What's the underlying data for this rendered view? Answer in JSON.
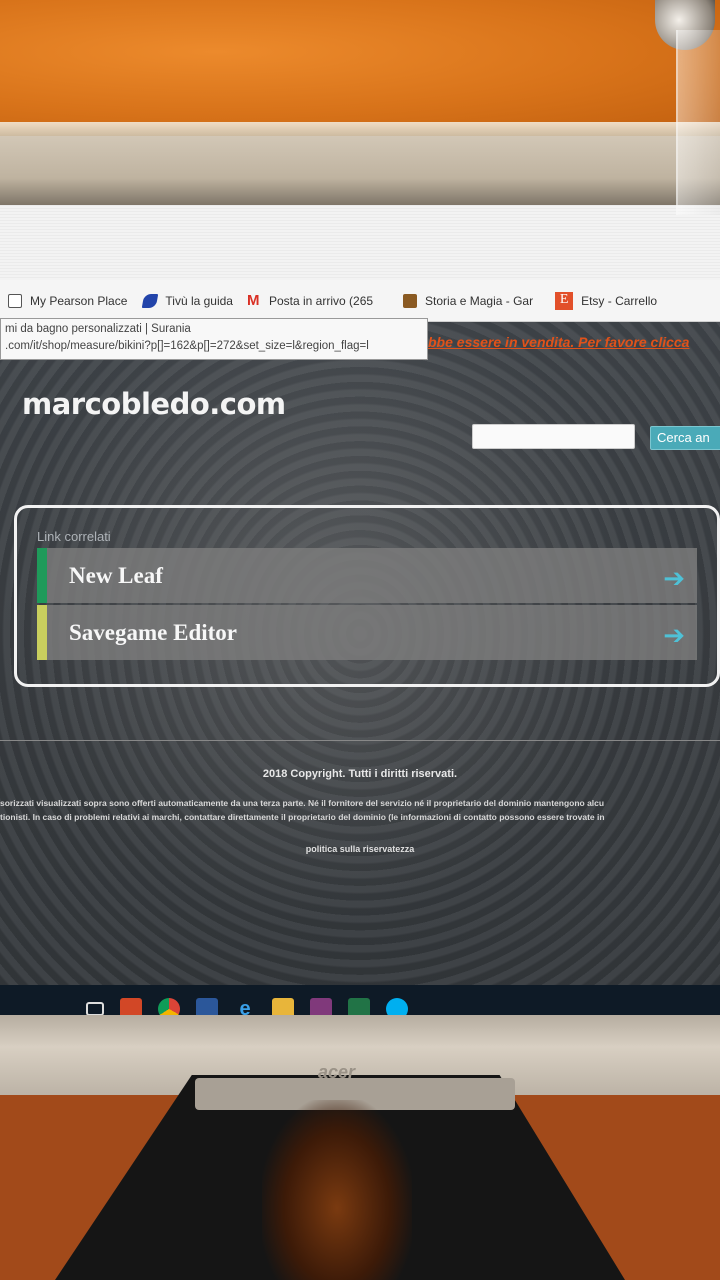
{
  "bookmarks": [
    {
      "label": "My Pearson Place",
      "icon": "page-icon"
    },
    {
      "label": "Tivù la guida",
      "icon": "flag-icon"
    },
    {
      "label": "Posta in arrivo (265",
      "icon": "gmail-icon"
    },
    {
      "label": "Storia e Magia - Gar",
      "icon": "chest-icon"
    },
    {
      "label": "Etsy - Carrello",
      "icon": "etsy-icon"
    }
  ],
  "etsy_glyph": "E",
  "gmail_glyph": "M",
  "tooltip": {
    "title": "mi da bagno personalizzati | Surania",
    "url": ".com/it/shop/measure/bikini?p[]=162&p[]=272&set_size=l&region_flag=l"
  },
  "notice": "bbe essere in vendita. Per favore clicca",
  "site": {
    "title": "marcobledo.com",
    "search_value": "",
    "search_button": "Cerca an"
  },
  "related": {
    "label": "Link correlati",
    "links": [
      {
        "text": "New Leaf",
        "accent": "#1f9a5a"
      },
      {
        "text": "Savegame Editor",
        "accent": "#c9cf5e"
      }
    ],
    "arrow": "➔"
  },
  "footer": {
    "copyright": "2018 Copyright. Tutti i diritti riservati.",
    "disclaimer_line1": "sorizzati visualizzati sopra sono offerti automaticamente da una terza parte. Né il fornitore del servizio né il proprietario del dominio mantengono alcu",
    "disclaimer_line2": "tionisti. In caso di problemi relativi ai marchi, contattare direttamente il proprietario del dominio (le informazioni di contatto possono essere trovate in",
    "privacy": "politica sulla riservatezza"
  },
  "monitor": {
    "brand": "acer"
  }
}
